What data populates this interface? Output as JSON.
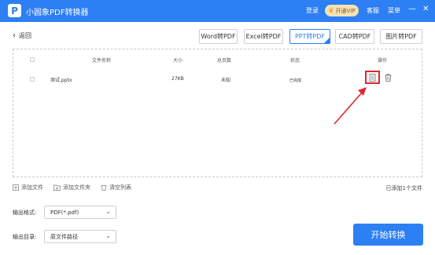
{
  "app": {
    "title": "小圆象PDF转换器",
    "logo_glyph": "P",
    "brand_color": "#2d7ff4"
  },
  "titlebar": {
    "login": "登录",
    "vip_button": "开通VIP",
    "vip_icon": "crown-icon",
    "service": "客服",
    "menu": "菜单",
    "minimize_glyph": "—",
    "close_glyph": "✕"
  },
  "nav": {
    "back": "返回",
    "back_glyph": "‹"
  },
  "tabs": [
    {
      "label": "Word转PDF",
      "active": false
    },
    {
      "label": "Excel转PDF",
      "active": false
    },
    {
      "label": "PPT转PDF",
      "active": true
    },
    {
      "label": "CAD转PDF",
      "active": false
    },
    {
      "label": "图片转PDF",
      "active": false
    }
  ],
  "table": {
    "headers": {
      "name": "文件名称",
      "size": "大小",
      "pages": "总页数",
      "status": "状态",
      "action": "操作"
    },
    "rows": [
      {
        "name": "测试.pptx",
        "size": "27KB",
        "pages": "未知",
        "status": "已完成"
      }
    ],
    "action_icons": [
      "document-icon",
      "trash-icon"
    ],
    "highlight_color": "#e0282e"
  },
  "toolbar": {
    "add_file": "添加文件",
    "add_folder": "添加文件夹",
    "clear_list": "清空列表",
    "added_count": "已添加1个文件"
  },
  "output": {
    "format_label": "输出格式:",
    "format_value": "PDF(*.pdf)",
    "dir_label": "输出目录:",
    "dir_value": "原文件路径"
  },
  "start_button": "开始转换"
}
